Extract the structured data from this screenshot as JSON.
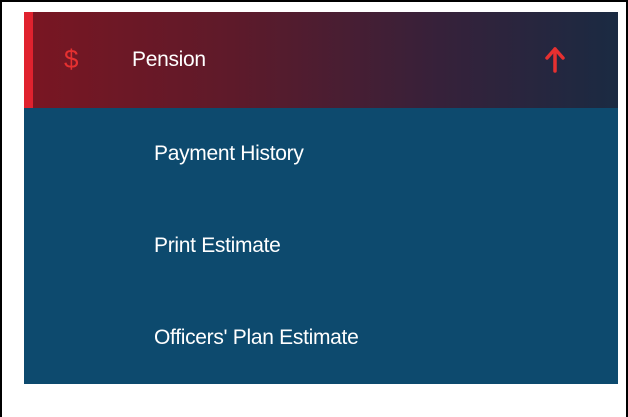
{
  "menu": {
    "header": {
      "icon": "dollar-icon",
      "icon_glyph": "$",
      "label": "Pension",
      "toggle_icon": "arrow-up-icon",
      "accent_color": "#e0222e"
    },
    "items": [
      {
        "label": "Payment History"
      },
      {
        "label": "Print Estimate"
      },
      {
        "label": "Officers' Plan Estimate"
      }
    ],
    "submenu_background": "#0d4a6e"
  }
}
